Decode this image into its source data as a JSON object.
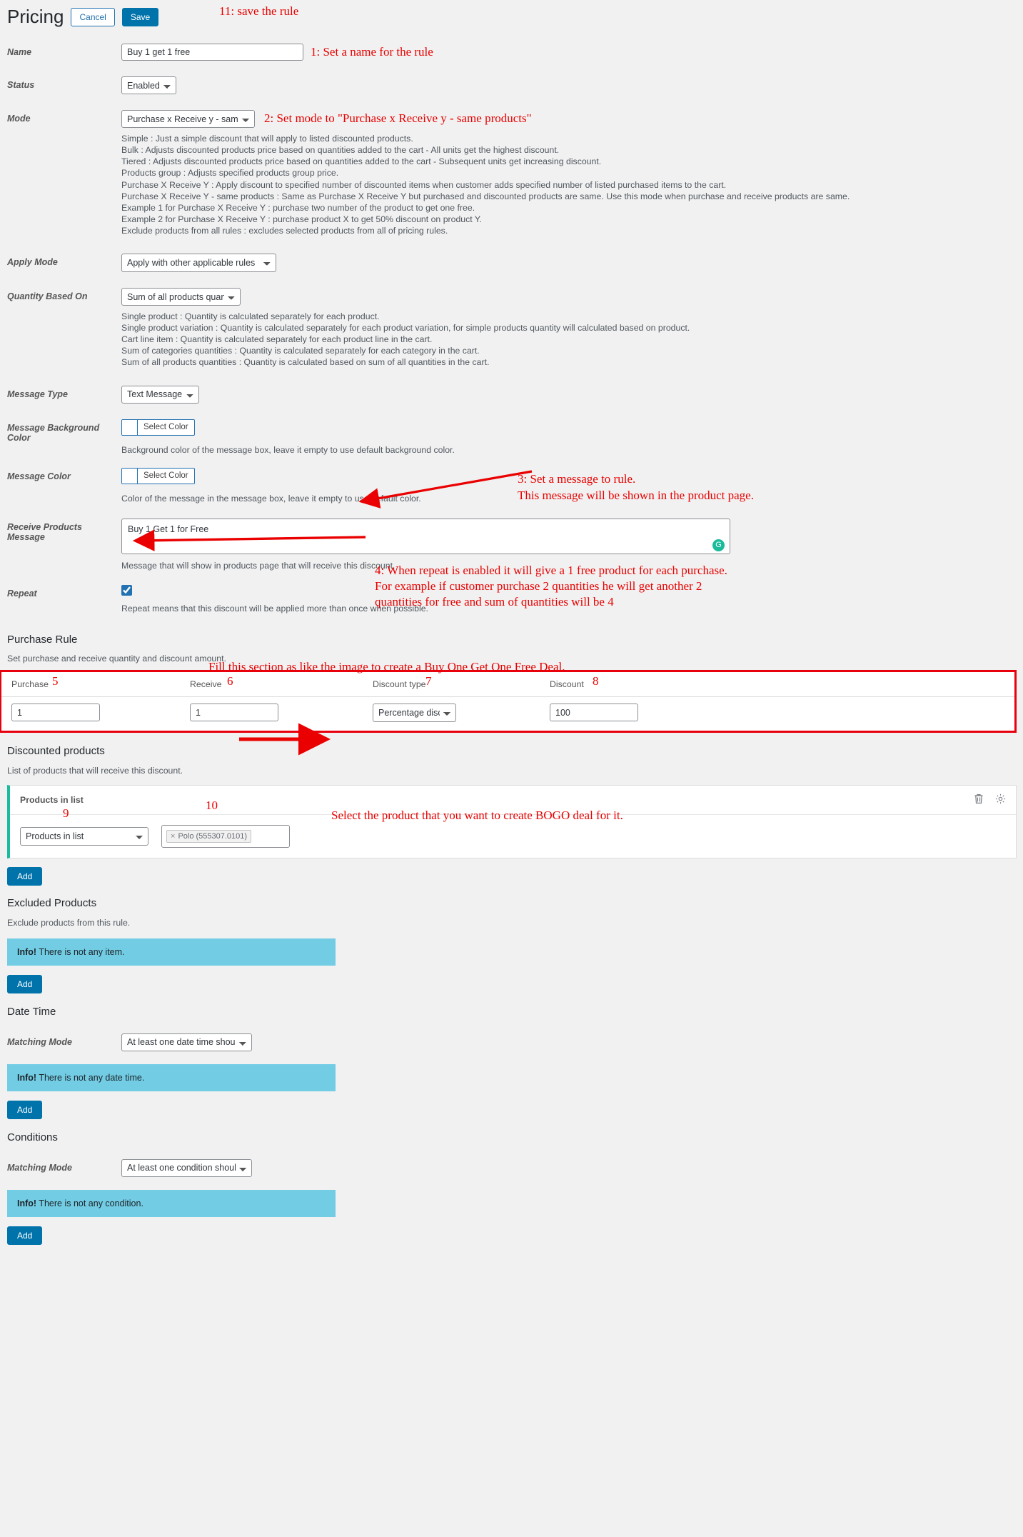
{
  "header": {
    "title": "Pricing",
    "cancel_label": "Cancel",
    "save_label": "Save"
  },
  "fields": {
    "name": {
      "label": "Name",
      "value": "Buy 1 get 1 free"
    },
    "status": {
      "label": "Status",
      "value": "Enabled"
    },
    "mode": {
      "label": "Mode",
      "value": "Purchase x Receive y - same products",
      "descriptions": [
        "Simple : Just a simple discount that will apply to listed discounted products.",
        "Bulk : Adjusts discounted products price based on quantities added to the cart - All units get the highest discount.",
        "Tiered : Adjusts discounted products price based on quantities added to the cart - Subsequent units get increasing discount.",
        "Products group : Adjusts specified products group price.",
        "Purchase X Receive Y : Apply discount to specified number of discounted items when customer adds specified number of listed purchased items to the cart.",
        "Purchase X Receive Y - same products : Same as Purchase X Receive Y but purchased and discounted products are same. Use this mode when purchase and receive products are same.",
        "Example 1 for Purchase X Receive Y : purchase two number of the product to get one free.",
        "Example 2 for Purchase X Receive Y : purchase product X to get 50% discount on product Y.",
        "Exclude products from all rules : excludes selected products from all of pricing rules."
      ]
    },
    "apply_mode": {
      "label": "Apply Mode",
      "value": "Apply with other applicable rules"
    },
    "quantity_based_on": {
      "label": "Quantity Based On",
      "value": "Sum of all products quantities",
      "descriptions": [
        "Single product : Quantity is calculated separately for each product.",
        "Single product variation : Quantity is calculated separately for each product variation, for simple products quantity will calculated based on product.",
        "Cart line item : Quantity is calculated separately for each product line in the cart.",
        "Sum of categories quantities : Quantity is calculated separately for each category in the cart.",
        "Sum of all products quantities : Quantity is calculated based on sum of all quantities in the cart."
      ]
    },
    "message_type": {
      "label": "Message Type",
      "value": "Text Message"
    },
    "message_background_color": {
      "label": "Message Background Color",
      "button_label": "Select Color",
      "hint": "Background color of the message box, leave it empty to use default background color."
    },
    "message_color": {
      "label": "Message Color",
      "button_label": "Select Color",
      "hint": "Color of the message in the message box, leave it empty to use default color."
    },
    "receive_products_message": {
      "label": "Receive Products Message",
      "value": "Buy 1 Get 1 for Free",
      "hint": "Message that will show in products page that will receive this discount."
    },
    "repeat": {
      "label": "Repeat",
      "checked": true,
      "hint": "Repeat means that this discount will be applied more than once when possible."
    }
  },
  "purchase_rule": {
    "title": "Purchase Rule",
    "subtitle": "Set purchase and receive quantity and discount amount.",
    "columns": [
      "Purchase",
      "Receive",
      "Discount type",
      "Discount"
    ],
    "row": {
      "purchase": "1",
      "receive": "1",
      "discount_type": "Percentage discount",
      "discount": "100"
    }
  },
  "discounted_products": {
    "title": "Discounted products",
    "subtitle": "List of products that will receive this discount.",
    "card_title": "Products in list",
    "list_select": "Products in list",
    "token": "Polo (555307.0101)",
    "token_remove": "×",
    "trash_icon": "trash-icon",
    "gear_icon": "gear-icon",
    "add_label": "Add"
  },
  "excluded_products": {
    "title": "Excluded Products",
    "subtitle": "Exclude products from this rule.",
    "info_strong": "Info!",
    "info_text": " There is not any item.",
    "add_label": "Add"
  },
  "date_time": {
    "title": "Date Time",
    "matching_mode_label": "Matching Mode",
    "matching_mode_value": "At least one date time should match",
    "info_strong": "Info!",
    "info_text": " There is not any date time.",
    "add_label": "Add"
  },
  "conditions": {
    "title": "Conditions",
    "matching_mode_label": "Matching Mode",
    "matching_mode_value": "At least one condition should match",
    "info_strong": "Info!",
    "info_text": " There is not any condition.",
    "add_label": "Add"
  },
  "annotations": {
    "a11": "11: save the rule",
    "a1": "1: Set a name for the rule",
    "a2": "2: Set mode to \"Purchase x Receive y - same products\"",
    "a3_line1": "3: Set a message to rule.",
    "a3_line2": "This message will be shown in the product page.",
    "a4_line1": "4: When repeat is enabled it will give a 1 free product for each purchase.",
    "a4_line2": "For example if customer purchase 2 quantities he will get another 2",
    "a4_line3": "quantities for free and sum of quantities will be 4",
    "a_fill": "Fill this section as like the image to create a Buy One Get One Free Deal.",
    "n5": "5",
    "n6": "6",
    "n7": "7",
    "n8": "8",
    "n9": "9",
    "n10": "10",
    "a_select_product": "Select the product that you want to create BOGO deal for it.",
    "color": "#ea0000"
  }
}
